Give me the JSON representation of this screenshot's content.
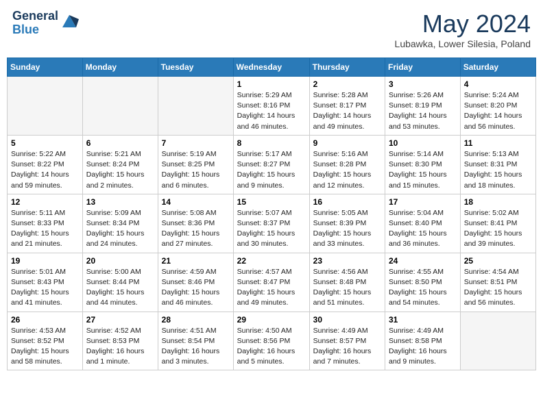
{
  "header": {
    "logo_general": "General",
    "logo_blue": "Blue",
    "title": "May 2024",
    "location": "Lubawka, Lower Silesia, Poland"
  },
  "weekdays": [
    "Sunday",
    "Monday",
    "Tuesday",
    "Wednesday",
    "Thursday",
    "Friday",
    "Saturday"
  ],
  "weeks": [
    [
      {
        "day": "",
        "info": ""
      },
      {
        "day": "",
        "info": ""
      },
      {
        "day": "",
        "info": ""
      },
      {
        "day": "1",
        "info": "Sunrise: 5:29 AM\nSunset: 8:16 PM\nDaylight: 14 hours\nand 46 minutes."
      },
      {
        "day": "2",
        "info": "Sunrise: 5:28 AM\nSunset: 8:17 PM\nDaylight: 14 hours\nand 49 minutes."
      },
      {
        "day": "3",
        "info": "Sunrise: 5:26 AM\nSunset: 8:19 PM\nDaylight: 14 hours\nand 53 minutes."
      },
      {
        "day": "4",
        "info": "Sunrise: 5:24 AM\nSunset: 8:20 PM\nDaylight: 14 hours\nand 56 minutes."
      }
    ],
    [
      {
        "day": "5",
        "info": "Sunrise: 5:22 AM\nSunset: 8:22 PM\nDaylight: 14 hours\nand 59 minutes."
      },
      {
        "day": "6",
        "info": "Sunrise: 5:21 AM\nSunset: 8:24 PM\nDaylight: 15 hours\nand 2 minutes."
      },
      {
        "day": "7",
        "info": "Sunrise: 5:19 AM\nSunset: 8:25 PM\nDaylight: 15 hours\nand 6 minutes."
      },
      {
        "day": "8",
        "info": "Sunrise: 5:17 AM\nSunset: 8:27 PM\nDaylight: 15 hours\nand 9 minutes."
      },
      {
        "day": "9",
        "info": "Sunrise: 5:16 AM\nSunset: 8:28 PM\nDaylight: 15 hours\nand 12 minutes."
      },
      {
        "day": "10",
        "info": "Sunrise: 5:14 AM\nSunset: 8:30 PM\nDaylight: 15 hours\nand 15 minutes."
      },
      {
        "day": "11",
        "info": "Sunrise: 5:13 AM\nSunset: 8:31 PM\nDaylight: 15 hours\nand 18 minutes."
      }
    ],
    [
      {
        "day": "12",
        "info": "Sunrise: 5:11 AM\nSunset: 8:33 PM\nDaylight: 15 hours\nand 21 minutes."
      },
      {
        "day": "13",
        "info": "Sunrise: 5:09 AM\nSunset: 8:34 PM\nDaylight: 15 hours\nand 24 minutes."
      },
      {
        "day": "14",
        "info": "Sunrise: 5:08 AM\nSunset: 8:36 PM\nDaylight: 15 hours\nand 27 minutes."
      },
      {
        "day": "15",
        "info": "Sunrise: 5:07 AM\nSunset: 8:37 PM\nDaylight: 15 hours\nand 30 minutes."
      },
      {
        "day": "16",
        "info": "Sunrise: 5:05 AM\nSunset: 8:39 PM\nDaylight: 15 hours\nand 33 minutes."
      },
      {
        "day": "17",
        "info": "Sunrise: 5:04 AM\nSunset: 8:40 PM\nDaylight: 15 hours\nand 36 minutes."
      },
      {
        "day": "18",
        "info": "Sunrise: 5:02 AM\nSunset: 8:41 PM\nDaylight: 15 hours\nand 39 minutes."
      }
    ],
    [
      {
        "day": "19",
        "info": "Sunrise: 5:01 AM\nSunset: 8:43 PM\nDaylight: 15 hours\nand 41 minutes."
      },
      {
        "day": "20",
        "info": "Sunrise: 5:00 AM\nSunset: 8:44 PM\nDaylight: 15 hours\nand 44 minutes."
      },
      {
        "day": "21",
        "info": "Sunrise: 4:59 AM\nSunset: 8:46 PM\nDaylight: 15 hours\nand 46 minutes."
      },
      {
        "day": "22",
        "info": "Sunrise: 4:57 AM\nSunset: 8:47 PM\nDaylight: 15 hours\nand 49 minutes."
      },
      {
        "day": "23",
        "info": "Sunrise: 4:56 AM\nSunset: 8:48 PM\nDaylight: 15 hours\nand 51 minutes."
      },
      {
        "day": "24",
        "info": "Sunrise: 4:55 AM\nSunset: 8:50 PM\nDaylight: 15 hours\nand 54 minutes."
      },
      {
        "day": "25",
        "info": "Sunrise: 4:54 AM\nSunset: 8:51 PM\nDaylight: 15 hours\nand 56 minutes."
      }
    ],
    [
      {
        "day": "26",
        "info": "Sunrise: 4:53 AM\nSunset: 8:52 PM\nDaylight: 15 hours\nand 58 minutes."
      },
      {
        "day": "27",
        "info": "Sunrise: 4:52 AM\nSunset: 8:53 PM\nDaylight: 16 hours\nand 1 minute."
      },
      {
        "day": "28",
        "info": "Sunrise: 4:51 AM\nSunset: 8:54 PM\nDaylight: 16 hours\nand 3 minutes."
      },
      {
        "day": "29",
        "info": "Sunrise: 4:50 AM\nSunset: 8:56 PM\nDaylight: 16 hours\nand 5 minutes."
      },
      {
        "day": "30",
        "info": "Sunrise: 4:49 AM\nSunset: 8:57 PM\nDaylight: 16 hours\nand 7 minutes."
      },
      {
        "day": "31",
        "info": "Sunrise: 4:49 AM\nSunset: 8:58 PM\nDaylight: 16 hours\nand 9 minutes."
      },
      {
        "day": "",
        "info": ""
      }
    ]
  ]
}
